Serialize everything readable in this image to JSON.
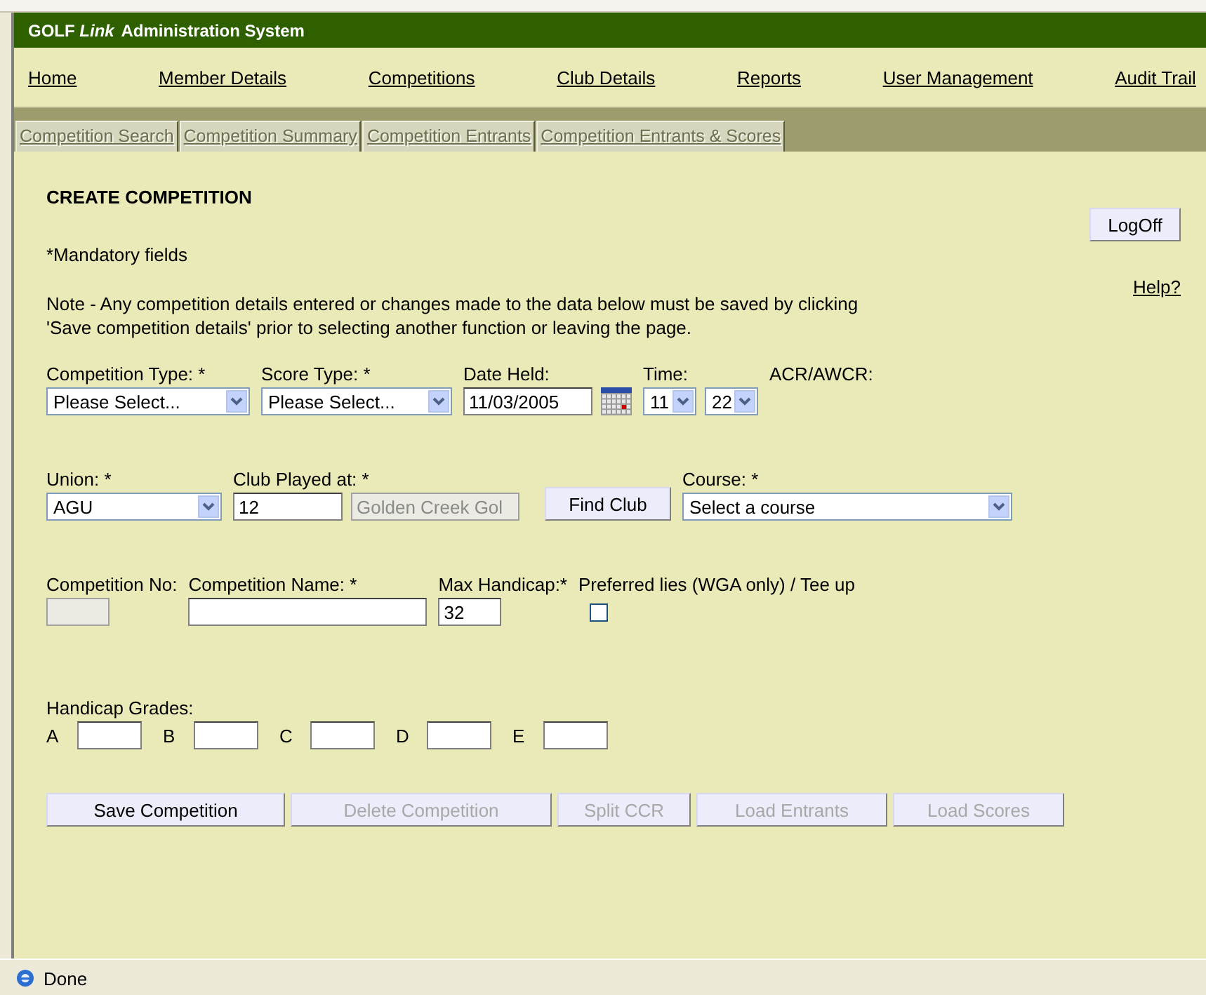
{
  "app_title": "GOLF *Link* Administration System",
  "nav": [
    "Home",
    "Member Details",
    "Competitions",
    "Club Details",
    "Reports",
    "User Management",
    "Audit Trail"
  ],
  "subtabs": [
    {
      "label": "Competition Search",
      "disabled": true
    },
    {
      "label": "Competition Summary",
      "disabled": true
    },
    {
      "label": "Competition Entrants",
      "disabled": true
    },
    {
      "label": "Competition Entrants & Scores",
      "disabled": true
    }
  ],
  "heading": "CREATE COMPETITION",
  "mandatory_note": "*Mandatory fields",
  "note": "Note - Any competition details entered or changes made to the data below must be saved by clicking 'Save competition details' prior to selecting another function or leaving the page.",
  "logoff": "LogOff",
  "help": "Help?",
  "form_rows": [
    [
      {
        "label": "Competition Type: *",
        "controls": [
          {
            "kind": "select",
            "value": "Please Select..."
          }
        ]
      },
      {
        "label": "Score Type: *",
        "controls": [
          {
            "kind": "select",
            "value": "Please Select..."
          }
        ]
      },
      {
        "label": "Date Held:",
        "controls": [
          {
            "kind": "text",
            "value": "11/03/2005"
          },
          {
            "kind": "calendar"
          }
        ]
      },
      {
        "label": "Time:",
        "controls": [
          {
            "kind": "select",
            "value": "11"
          },
          {
            "kind": "select",
            "value": "22"
          }
        ]
      },
      {
        "label": "ACR/AWCR:"
      }
    ],
    [
      {
        "label": "Union: *",
        "controls": [
          {
            "kind": "select",
            "value": "AGU"
          }
        ]
      },
      {
        "label": "Club Played at: *",
        "controls": [
          {
            "kind": "text",
            "value": "12"
          },
          {
            "kind": "text",
            "value": "Golden Creek Gol",
            "disabled": true
          }
        ]
      },
      {
        "controls": [
          {
            "kind": "button",
            "value": "Find Club"
          }
        ]
      },
      {
        "label": "Course: *",
        "controls": [
          {
            "kind": "select",
            "value": "Select a course"
          }
        ]
      }
    ],
    [
      {
        "label": "Competition No:",
        "controls": [
          {
            "kind": "text",
            "disabled": true
          }
        ]
      },
      {
        "label": "Competition Name: *",
        "controls": [
          {
            "kind": "text"
          }
        ]
      },
      {
        "label": "Max Handicap:*",
        "controls": [
          {
            "kind": "text",
            "value": "32"
          }
        ]
      },
      {
        "label": "Preferred lies (WGA only) / Tee up",
        "controls": [
          {
            "kind": "checkbox",
            "checked": false
          }
        ]
      }
    ]
  ],
  "grades_label": "Handicap Grades:",
  "grades": [
    "A",
    "B",
    "C",
    "D",
    "E"
  ],
  "buttons": [
    {
      "label": "Save Competition",
      "disabled": false
    },
    {
      "label": "Delete Competition",
      "disabled": true
    },
    {
      "label": "Split CCR",
      "disabled": true
    },
    {
      "label": "Load Entrants",
      "disabled": true
    },
    {
      "label": "Load Scores",
      "disabled": true
    }
  ],
  "status": "Done"
}
